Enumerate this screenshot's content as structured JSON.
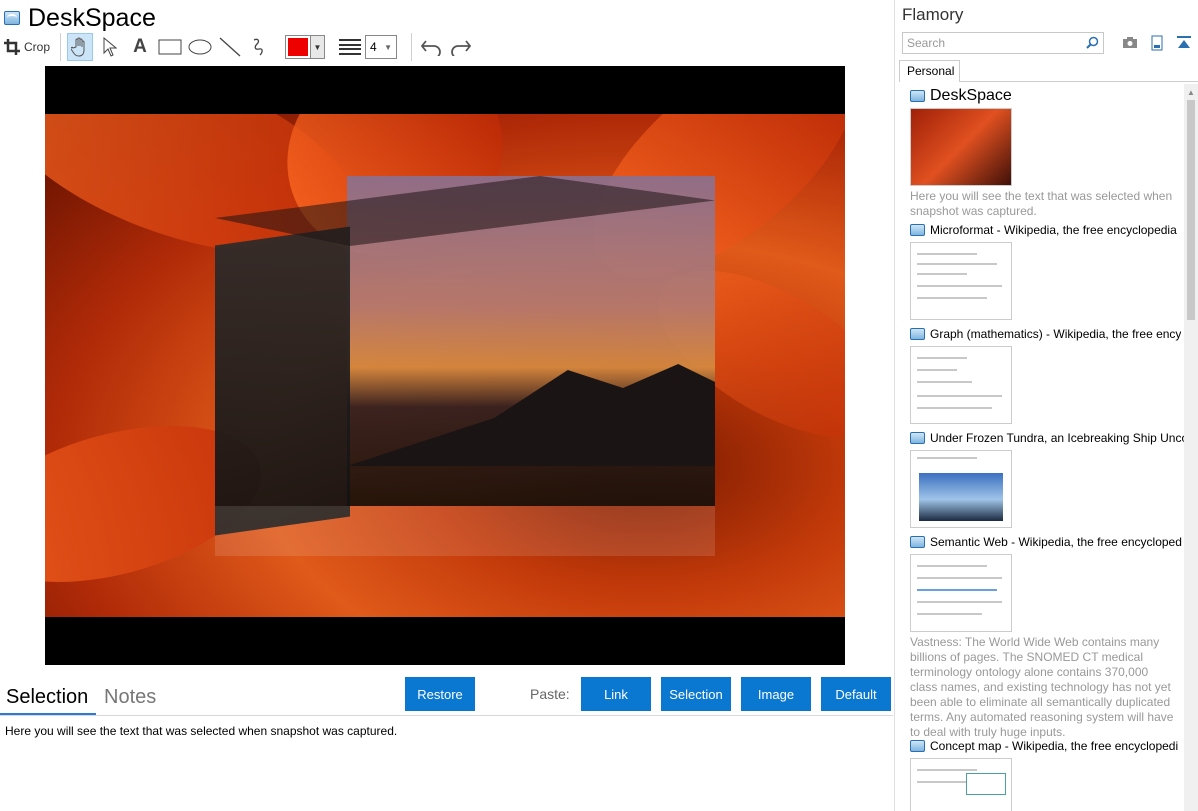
{
  "app": {
    "title": "DeskSpace"
  },
  "toolbar": {
    "crop_label": "Crop",
    "text_tool_glyph": "A",
    "line_width": "4",
    "color": "#ee0000"
  },
  "bottom": {
    "tabs": [
      "Selection",
      "Notes"
    ],
    "restore": "Restore",
    "paste_label": "Paste:",
    "paste_buttons": [
      "Link",
      "Selection",
      "Image",
      "Default"
    ],
    "selection_text": "Here you will see the text that was selected when snapshot was captured."
  },
  "sidebar": {
    "title": "Flamory",
    "search_placeholder": "Search",
    "tab": "Personal",
    "items": [
      {
        "title": "DeskSpace",
        "desc": "Here you will see the text that was selected when snapshot was captured."
      },
      {
        "title": "Microformat - Wikipedia, the free encyclopedia"
      },
      {
        "title": "Graph (mathematics) - Wikipedia, the free ency"
      },
      {
        "title": "Under Frozen Tundra, an Icebreaking Ship Unco"
      },
      {
        "title": "Semantic Web - Wikipedia, the free encycloped",
        "desc": "Vastness: The World Wide Web contains many billions of pages. The SNOMED CT medical terminology ontology alone contains 370,000 class names, and existing technology has not yet been able to eliminate all semantically duplicated terms. Any automated reasoning system will have to deal with truly huge inputs."
      },
      {
        "title": "Concept map - Wikipedia, the free encyclopedi"
      }
    ]
  },
  "colors": {
    "accent": "#0a78d0",
    "tab_underline": "#2a7ad4"
  }
}
